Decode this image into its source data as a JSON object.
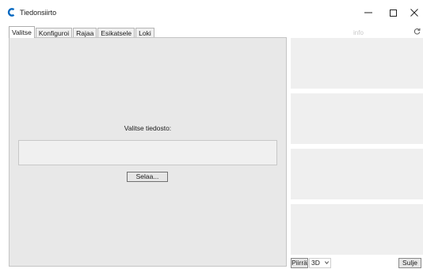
{
  "window": {
    "title": "Tiedonsiirto",
    "controls": {
      "minimize_icon": "minimize-icon",
      "maximize_icon": "maximize-icon",
      "close_icon": "close-icon"
    }
  },
  "tabs": [
    {
      "label": "Valitse",
      "active": true
    },
    {
      "label": "Konfiguroi",
      "active": false
    },
    {
      "label": "Rajaa",
      "active": false
    },
    {
      "label": "Esikatsele",
      "active": false
    },
    {
      "label": "Loki",
      "active": false
    }
  ],
  "main": {
    "prompt": "Valitse tiedosto:",
    "file_path_value": "",
    "browse_label": "Selaa..."
  },
  "side": {
    "info_label": "info",
    "refresh_icon": "refresh-icon"
  },
  "bottom": {
    "draw_label": "Piirrä",
    "mode_value": "3D",
    "close_label": "Sulje"
  },
  "colors": {
    "accent": "#0067c0",
    "panel_bg": "#e8e8e8",
    "side_panel_bg": "#efefef"
  }
}
